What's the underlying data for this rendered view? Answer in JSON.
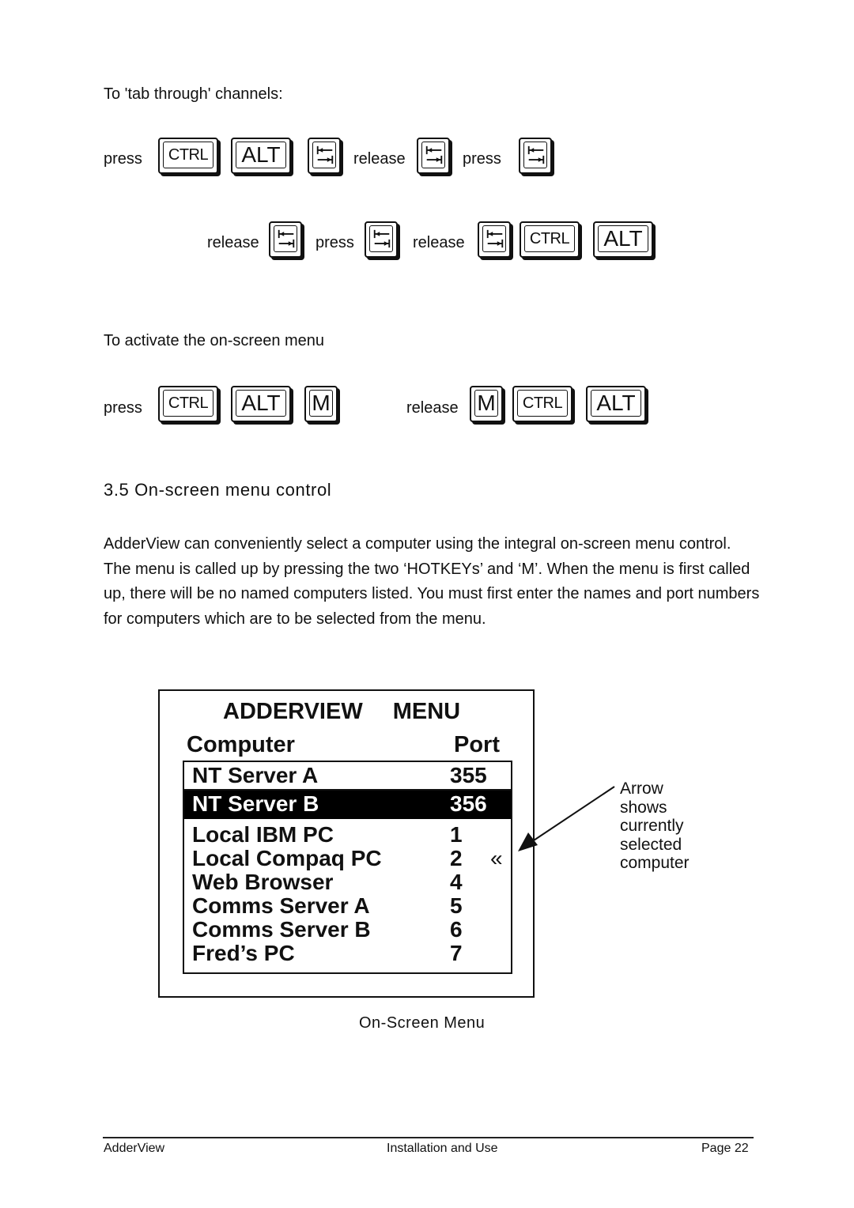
{
  "tab_through": {
    "intro": "To 'tab through' channels:",
    "line1": {
      "press": "press",
      "release": "release",
      "press2": "press"
    },
    "line2": {
      "release": "release",
      "press": "press",
      "release2": "release"
    }
  },
  "activate_menu": {
    "intro": "To activate the on-screen menu",
    "press": "press",
    "release": "release"
  },
  "keys": {
    "ctrl": "CTRL",
    "alt": "ALT",
    "m": "M",
    "tab_icon": "tab-key-icon"
  },
  "section": {
    "heading": "3.5 On-screen menu control",
    "paragraph": "AdderView can conveniently select a computer using the integral on-screen menu control. The menu is called up by pressing the two ‘HOTKEYs’ and ‘M’. When the menu is first called up, there will be no named computers listed. You must first enter the names and port numbers for computers which are to be selected from the menu."
  },
  "menu": {
    "title_left": "ADDERVIEW",
    "title_right": "MENU",
    "col_computer": "Computer",
    "col_port": "Port",
    "rows": [
      {
        "name": "NT Server A",
        "port": "355",
        "highlighted": false
      },
      {
        "name": "NT Server B",
        "port": "356",
        "highlighted": true
      },
      {
        "name": "Local IBM PC",
        "port": "1",
        "highlighted": false
      },
      {
        "name": "Local Compaq PC",
        "port": "2",
        "highlighted": false,
        "current": true
      },
      {
        "name": "Web Browser",
        "port": "4",
        "highlighted": false
      },
      {
        "name": "Comms Server A",
        "port": "5",
        "highlighted": false
      },
      {
        "name": "Comms Server B",
        "port": "6",
        "highlighted": false
      },
      {
        "name": "Fred’s PC",
        "port": "7",
        "highlighted": false
      }
    ],
    "current_marker": "«",
    "callout": [
      "Arrow",
      "shows",
      "currently",
      "selected",
      "computer"
    ],
    "caption": "On-Screen Menu"
  },
  "footer": {
    "left": "AdderView",
    "center": "Installation and Use",
    "right": "Page 22"
  }
}
